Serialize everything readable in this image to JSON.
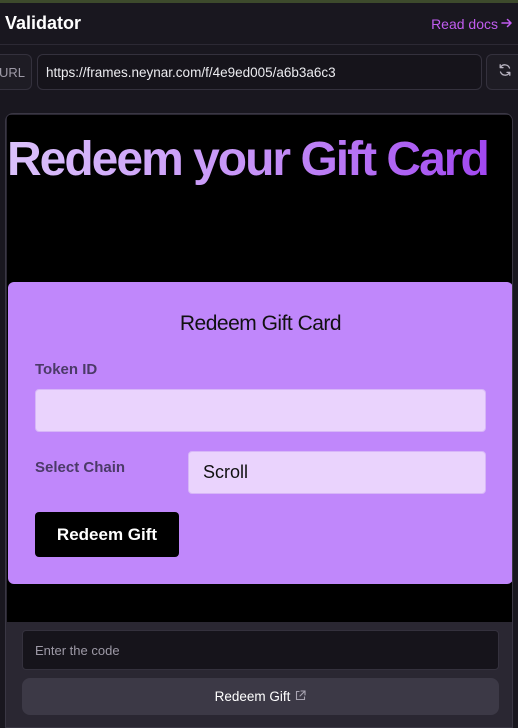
{
  "header": {
    "title": "Validator",
    "docs_label": "Read docs"
  },
  "urlbar": {
    "label": "URL",
    "value": "https://frames.neynar.com/f/4e9ed005/a6b3a6c3"
  },
  "frame": {
    "heading": "Redeem your Gift Card",
    "card": {
      "title": "Redeem Gift Card",
      "token_label": "Token ID",
      "token_value": "",
      "chain_label": "Select Chain",
      "chain_value": "Scroll",
      "button_label": "Redeem Gift"
    },
    "input_placeholder": "Enter the code",
    "action_button_label": "Redeem Gift"
  },
  "colors": {
    "accent": "#c15cf0",
    "card_bg": "#c087fb",
    "input_bg": "#ead3fd",
    "app_bg": "#19171f"
  },
  "icons": {
    "docs": "arrow-right-icon",
    "refresh": "refresh-icon",
    "action": "external-link-icon"
  }
}
